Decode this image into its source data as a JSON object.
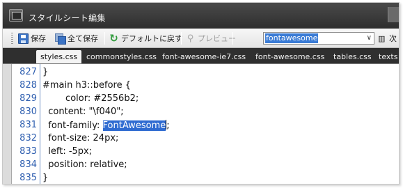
{
  "window": {
    "title": "スタイルシート編集"
  },
  "toolbar": {
    "save_label": "保存",
    "save_all_label": "全て保存",
    "revert_label": "デフォルトに戻す",
    "preview_label": "プレビュー",
    "search_value": "fontawesome",
    "find_label": "次"
  },
  "tabs": [
    {
      "label": "styles.css",
      "active": true
    },
    {
      "label": "commonstyles.css",
      "active": false
    },
    {
      "label": "font-awesome-ie7.css",
      "active": false
    },
    {
      "label": "font-awesome.css",
      "active": false
    },
    {
      "label": "tables.css",
      "active": false
    },
    {
      "label": "texts",
      "active": false
    }
  ],
  "editor": {
    "lines": [
      {
        "num": "827",
        "text": "}"
      },
      {
        "num": "828",
        "text": "#main h3::before {"
      },
      {
        "num": "829",
        "text": "        color: #2556b2;"
      },
      {
        "num": "830",
        "text": "  content: \"\\f040\";"
      },
      {
        "num": "831",
        "text_before": "  font-family: ",
        "selected": "FontAwesome",
        "text_after": ";"
      },
      {
        "num": "832",
        "text": "  font-size: 24px;"
      },
      {
        "num": "833",
        "text": "  left: -5px;"
      },
      {
        "num": "834",
        "text": "  position: relative;"
      },
      {
        "num": "835",
        "text": "}"
      }
    ]
  },
  "colors": {
    "selection": "#2f6bd1",
    "line_numbers": "#2f5fb0",
    "title_bar": "#3a3a3a",
    "tab_bar": "#2f2f2f"
  }
}
